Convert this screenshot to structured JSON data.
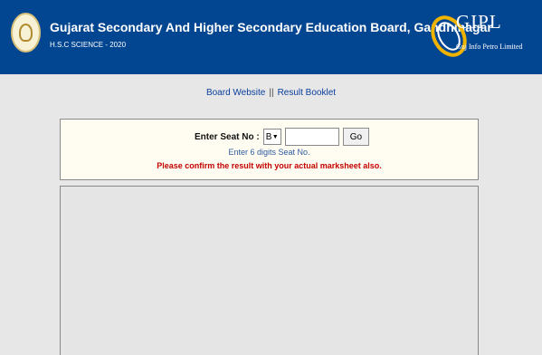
{
  "header": {
    "title": "Gujarat Secondary And Higher Secondary Education Board, Gandhinagar",
    "subtitle": "H.S.C SCIENCE - 2020",
    "logo_right": {
      "name": "GIPL",
      "tagline": "Guj Info Petro Limited"
    }
  },
  "nav": {
    "board_website": "Board Website",
    "separator": "||",
    "result_booklet": "Result Booklet"
  },
  "seat_form": {
    "label": "Enter Seat No :",
    "series_value": "B",
    "seat_value": "",
    "go_label": "Go",
    "hint": "Enter 6 digits Seat No.",
    "warning": "Please confirm the result with your actual marksheet also."
  },
  "colors": {
    "header_bg": "#024591",
    "page_bg": "#e7e7e7",
    "link": "#0a3e9c",
    "hint": "#2c5aa0",
    "warning": "#c40000"
  }
}
